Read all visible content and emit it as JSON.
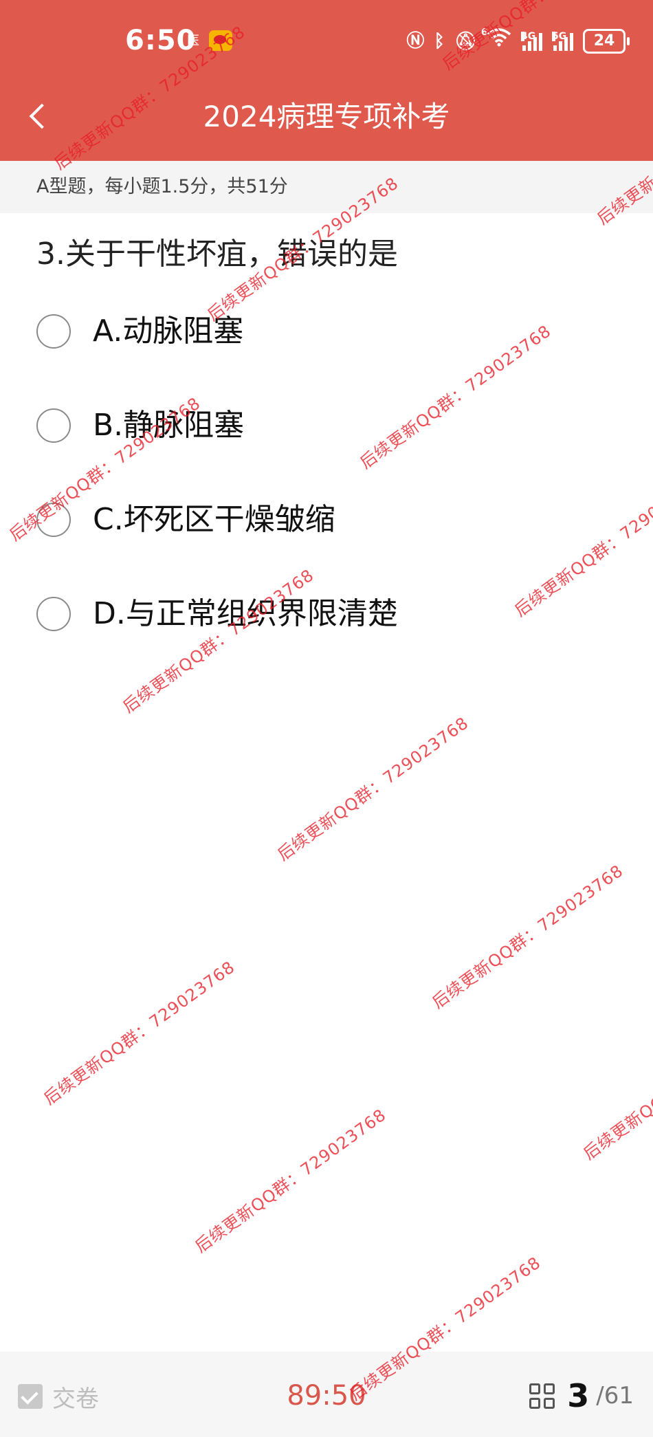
{
  "status_bar": {
    "time": "6:50",
    "app_badge": "医",
    "battery": "24",
    "net_4g": "4G",
    "net_5g": "5G",
    "wifi_index": "6"
  },
  "header": {
    "title": "2024病理专项补考"
  },
  "section": {
    "info": "A型题，每小题1.5分，共51分"
  },
  "question": {
    "text": "3.关于干性坏疽，错误的是",
    "options": [
      {
        "label": "A.动脉阻塞"
      },
      {
        "label": "B.静脉阻塞"
      },
      {
        "label": "C.坏死区干燥皱缩"
      },
      {
        "label": "D.与正常组织界限清楚"
      }
    ]
  },
  "footer": {
    "submit_label": "交卷",
    "timer": "89:50",
    "current": "3",
    "separator": "/",
    "total": "61"
  },
  "watermark": {
    "text": "后续更新QQ群：729023768"
  },
  "colors": {
    "header_bg": "#df5a4d",
    "timer": "#d9574b",
    "watermark": "#e81e28"
  }
}
